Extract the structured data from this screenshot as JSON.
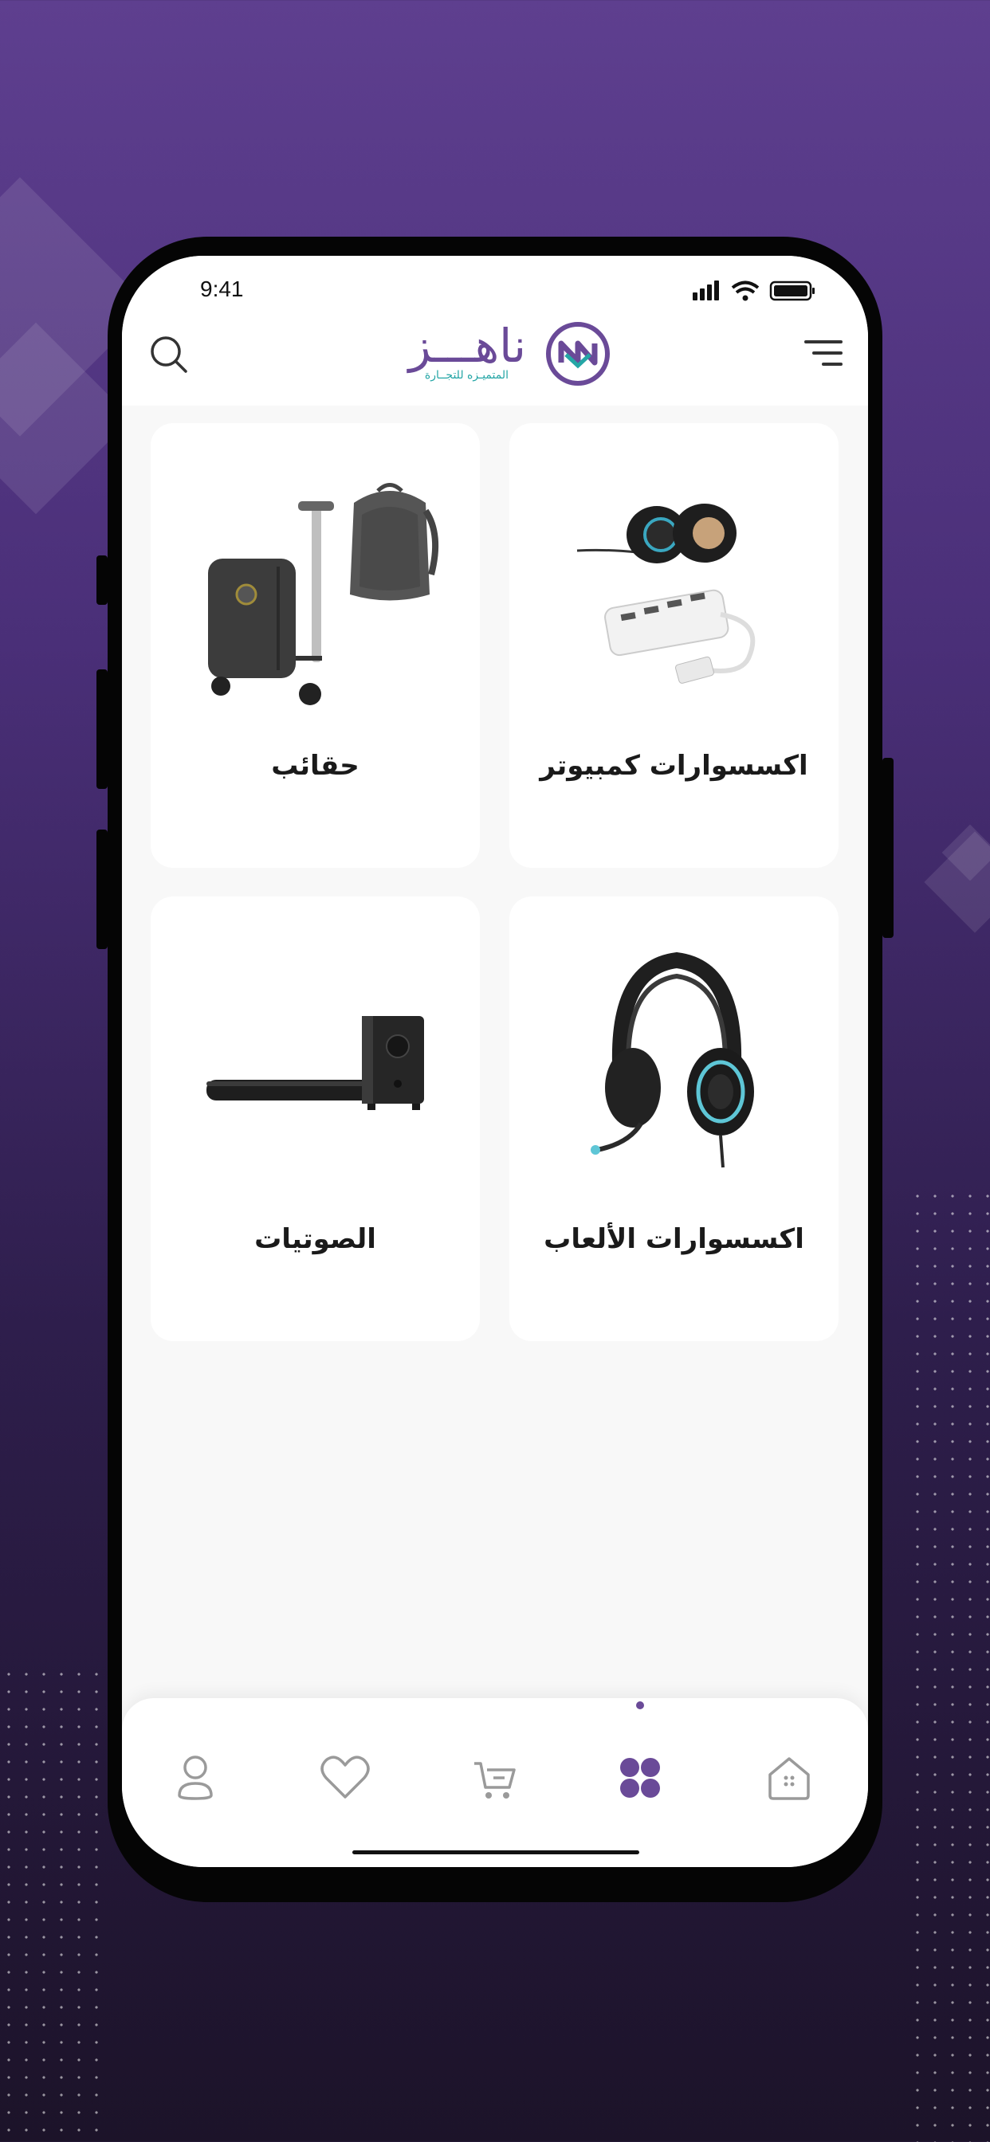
{
  "status_bar": {
    "time": "9:41"
  },
  "header": {
    "brand_name": "ناهـــز",
    "brand_tagline": "المتميـزه للتجــارة",
    "search_icon": "search-icon",
    "menu_icon": "menu-icon"
  },
  "categories": [
    {
      "label": "اكسسوارات كمبيوتر",
      "image": "computer-accessories"
    },
    {
      "label": "حقائب",
      "image": "bags"
    },
    {
      "label": "اكسسوارات الألعاب",
      "image": "gaming-headset"
    },
    {
      "label": "الصوتيات",
      "image": "soundbar"
    }
  ],
  "bottom_nav": {
    "items": [
      "home-icon",
      "categories-icon",
      "cart-icon",
      "favorites-icon",
      "profile-icon"
    ],
    "active": "categories-icon"
  },
  "colors": {
    "accent": "#6a4a98",
    "teal": "#25a6a6",
    "icon_gray": "#9a9a9a"
  }
}
